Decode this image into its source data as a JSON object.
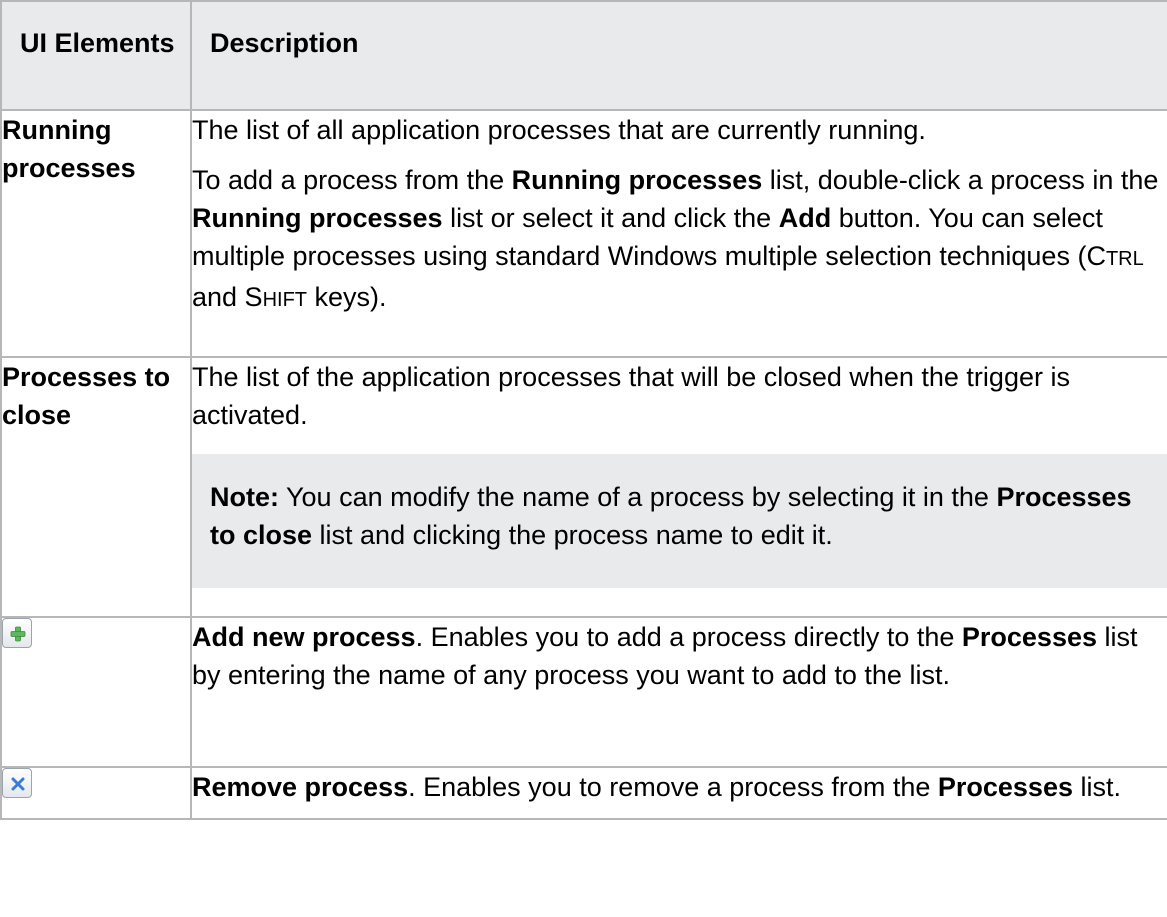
{
  "header": {
    "col1_label": "UI Elements",
    "col2_label": "Description"
  },
  "rows": [
    {
      "label": "Running processes",
      "p1": "The list of all application processes that are currently running.",
      "p2_parts": [
        "To add a process from the ",
        "Running processes",
        " list, double-click a process in the ",
        "Running processes",
        " list or select it and click the ",
        "Add",
        " button. You can select multiple processes using standard Windows multiple selection techniques (C",
        "TRL",
        " and S",
        "HIFT",
        " keys)."
      ]
    },
    {
      "label": "Processes to close",
      "p1": "The list of the application processes that will be closed when the trigger is activated.",
      "note_parts": [
        "Note:",
        " You can modify the name of a process by selecting it in the ",
        "Processes to close",
        " list and clicking the process name to edit it."
      ]
    },
    {
      "icon": "add-icon",
      "desc_parts": [
        "Add new process",
        ". Enables you to add a process directly to the ",
        "Processes",
        " list by entering the name of any process you want to add to the list."
      ]
    },
    {
      "icon": "remove-icon",
      "desc_parts": [
        "Remove process",
        ". Enables you to remove a process from the ",
        "Processes",
        " list."
      ]
    }
  ],
  "colors": {
    "header_bg": "#e8eaeb",
    "note_bg": "#e8eaeb",
    "border": "#b7b7b7",
    "add_icon_green": "#4caf50",
    "remove_icon_blue": "#3a7bd5"
  }
}
